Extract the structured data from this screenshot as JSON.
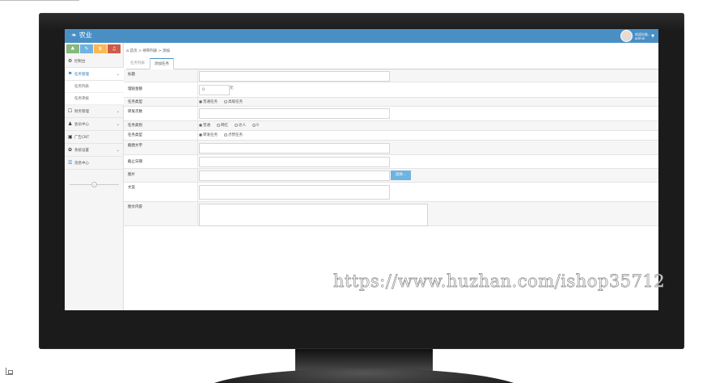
{
  "app": {
    "title": "农业"
  },
  "user": {
    "name": "欢迎光临,",
    "role": "admin"
  },
  "quick_buttons": [
    {
      "icon": "signal-icon",
      "glyph": "♣"
    },
    {
      "icon": "pencil-icon",
      "glyph": "✎"
    },
    {
      "icon": "users-icon",
      "glyph": "♛"
    },
    {
      "icon": "bell-icon",
      "glyph": "♫"
    }
  ],
  "sidebar": {
    "items": [
      {
        "label": "控制台",
        "icon": "dashboard-icon",
        "glyph": "⚙"
      },
      {
        "label": "任务管理",
        "icon": "flag-icon",
        "glyph": "⚑"
      },
      {
        "label": "任务列表",
        "sub": true
      },
      {
        "label": "任务审核",
        "sub": true
      },
      {
        "label": "财务管理",
        "icon": "wallet-icon",
        "glyph": "☐"
      },
      {
        "label": "会员中心",
        "icon": "user-icon",
        "glyph": "♟"
      },
      {
        "label": "广告CNT",
        "icon": "picture-icon",
        "glyph": "▣"
      },
      {
        "label": "系统设置",
        "icon": "cog-icon",
        "glyph": "✿"
      },
      {
        "label": "消息中心",
        "icon": "bookmark-icon",
        "glyph": "☰"
      }
    ]
  },
  "breadcrumb": {
    "home": "首页",
    "section": "待审列表",
    "current": "添加"
  },
  "tabs": [
    {
      "label": "任务列表"
    },
    {
      "label": "添加任务"
    }
  ],
  "form": {
    "fields": [
      {
        "label": "标题",
        "value": ""
      },
      {
        "label": "理赔金额",
        "value": "0",
        "unit": "元"
      },
      {
        "label": "任务类型",
        "options": [
          "普通任务",
          "高级任务"
        ],
        "selected": 0
      },
      {
        "label": "转发次数",
        "value": ""
      },
      {
        "label": "任务类别",
        "options": [
          "普通",
          "网红",
          "达人",
          "0"
        ],
        "selected": 0
      },
      {
        "label": "任务类型",
        "options": [
          "转发任务",
          "点赞任务"
        ],
        "selected": 0
      },
      {
        "label": "截图文字",
        "value": ""
      },
      {
        "label": "截止日期",
        "value": ""
      },
      {
        "label": "图片",
        "value": "",
        "button": "选择..."
      },
      {
        "label": "文案",
        "value": ""
      },
      {
        "label": "图文内容",
        "value": ""
      }
    ]
  },
  "watermark": "https://www.huzhan.com/ishop35712",
  "colors": {
    "header": "#4a8fc4",
    "accent": "#2b7dbc",
    "monitor": "#1b1b1b"
  }
}
